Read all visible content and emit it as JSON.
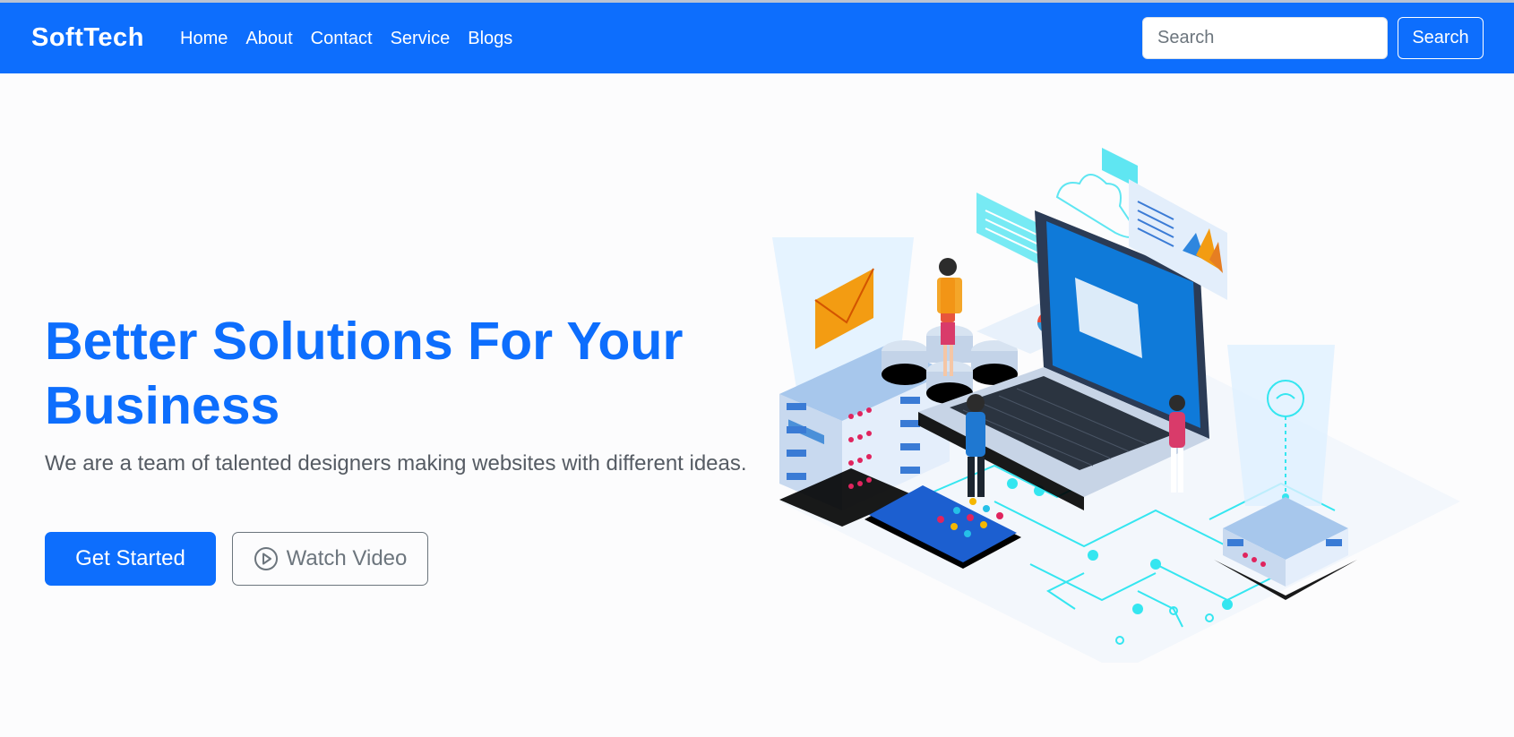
{
  "navbar": {
    "brand": "SoftTech",
    "links": [
      "Home",
      "About",
      "Contact",
      "Service",
      "Blogs"
    ],
    "search_placeholder": "Search",
    "search_button": "Search"
  },
  "hero": {
    "title": "Better Solutions For Your Business",
    "subtitle": "We are a team of talented designers making websites with different ideas.",
    "primary_button": "Get Started",
    "secondary_button": "Watch Video"
  },
  "icons": {
    "play": "play-circle-icon"
  },
  "colors": {
    "primary": "#0d6efd",
    "text_muted": "#555b63",
    "outline": "#6c757d",
    "background": "#fcfcfd"
  }
}
